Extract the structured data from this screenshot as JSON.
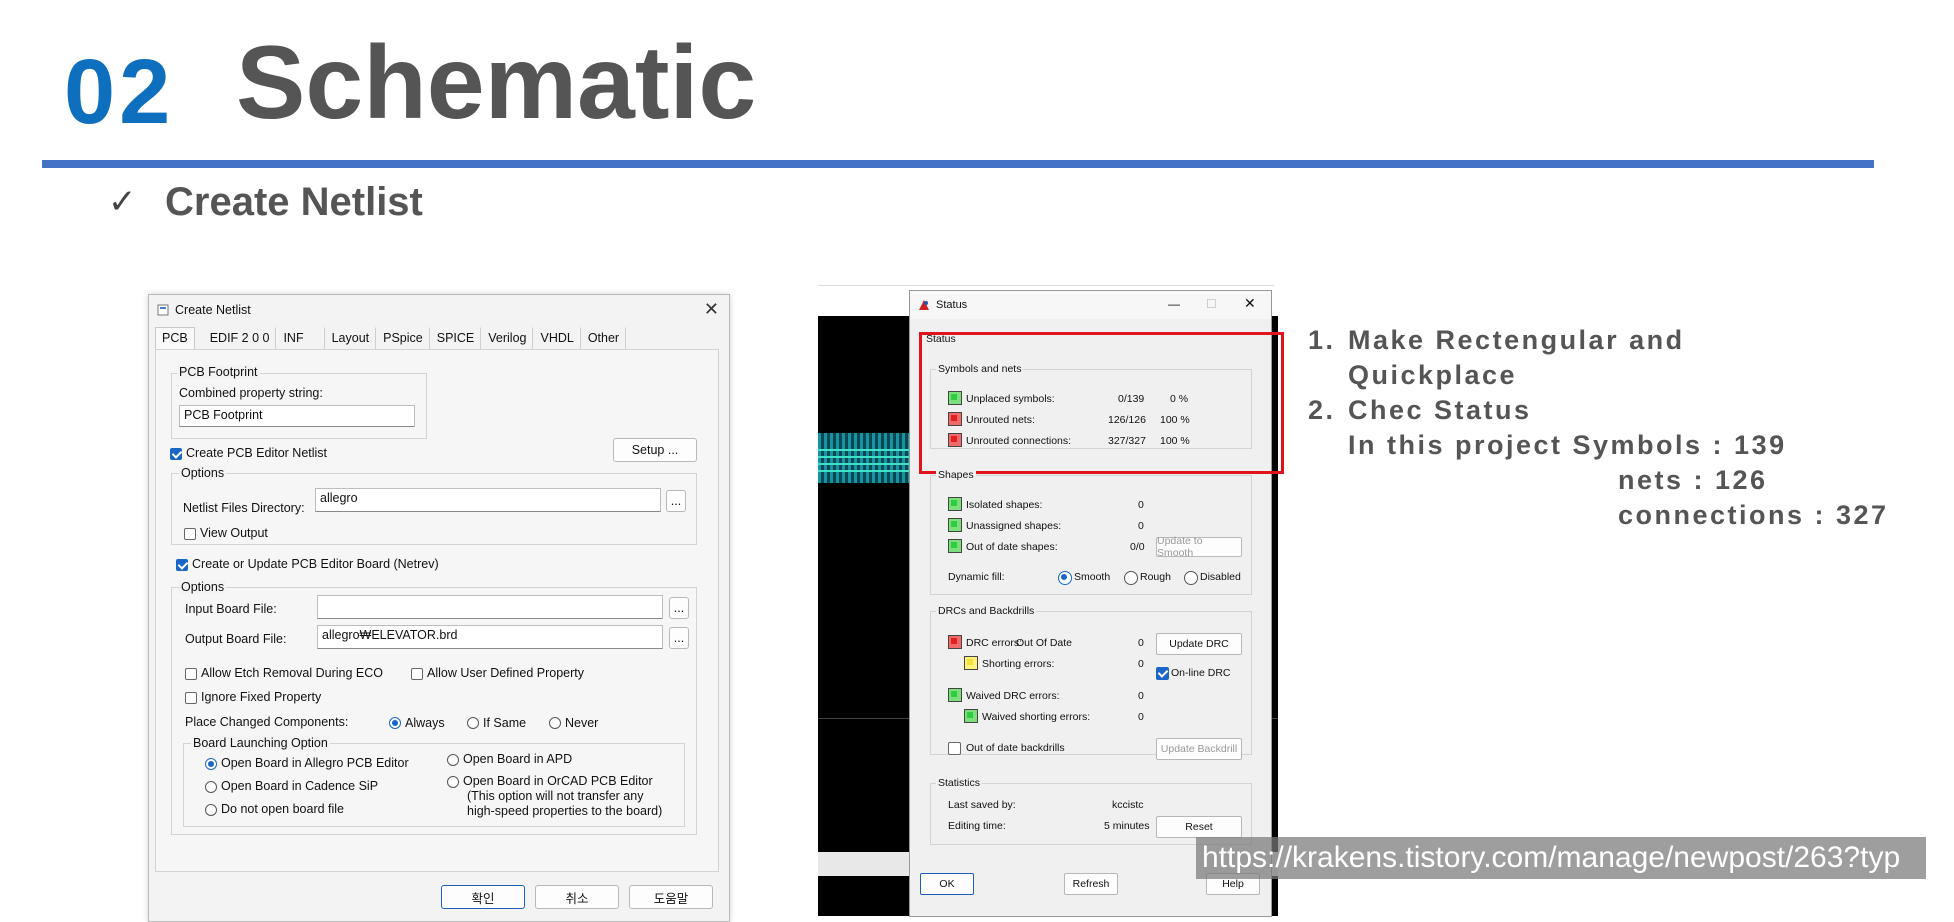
{
  "slide": {
    "number": "02",
    "title": "Schematic",
    "subtitle": "Create Netlist",
    "checkmark": "✓"
  },
  "netlist_dialog": {
    "title": "Create Netlist",
    "close": "✕",
    "tabs": [
      "PCB",
      "EDIF 2 0 0",
      "INF",
      "Layout",
      "PSpice",
      "SPICE",
      "Verilog",
      "VHDL",
      "Other"
    ],
    "footprint_group": "PCB Footprint",
    "combined_label": "Combined property string:",
    "combined_value": "PCB Footprint",
    "create_netlist": "Create PCB Editor Netlist",
    "setup_button": "Setup ...",
    "options1": "Options",
    "netlist_dir_label": "Netlist Files Directory:",
    "netlist_dir_value": "allegro",
    "browse": "...",
    "view_output": "View Output",
    "create_board": "Create or Update PCB Editor Board (Netrev)",
    "options2": "Options",
    "input_board_label": "Input Board File:",
    "input_board_value": "",
    "output_board_label": "Output Board File:",
    "output_board_value": "allegro₩ELEVATOR.brd",
    "allow_etch": "Allow Etch Removal During ECO",
    "allow_user": "Allow User Defined Property",
    "ignore_fixed": "Ignore Fixed Property",
    "place_changed_label": "Place Changed Components:",
    "place_always": "Always",
    "place_ifsame": "If Same",
    "place_never": "Never",
    "launch_group": "Board Launching Option",
    "open_allegro": "Open Board in Allegro PCB Editor",
    "open_apd": "Open Board in APD",
    "open_sip": "Open Board in Cadence SiP",
    "open_orcad": "Open Board in OrCAD PCB Editor",
    "orcad_note1": "(This option will not transfer any",
    "orcad_note2": "high-speed properties to the board)",
    "no_open": "Do not open board file",
    "ok": "확인",
    "cancel": "취소",
    "help": "도움말"
  },
  "status_dialog": {
    "title": "Status",
    "minimize": "—",
    "maximize": "☐",
    "close": "✕",
    "status_group": "Status",
    "symbols_group": "Symbols and nets",
    "unplaced_label": "Unplaced symbols:",
    "unplaced_value": "0/139",
    "unplaced_pct": "0 %",
    "unrouted_nets_label": "Unrouted nets:",
    "unrouted_nets_value": "126/126",
    "unrouted_nets_pct": "100 %",
    "unrouted_conn_label": "Unrouted connections:",
    "unrouted_conn_value": "327/327",
    "unrouted_conn_pct": "100 %",
    "shapes_group": "Shapes",
    "isolated_label": "Isolated shapes:",
    "isolated_value": "0",
    "unassigned_label": "Unassigned shapes:",
    "unassigned_value": "0",
    "outofdate_label": "Out of date shapes:",
    "outofdate_value": "0/0",
    "update_smooth": "Update to Smooth",
    "dynamic_fill": "Dynamic fill:",
    "fill_smooth": "Smooth",
    "fill_rough": "Rough",
    "fill_disabled": "Disabled",
    "drc_group": "DRCs and Backdrills",
    "drc_label": "DRC errors:",
    "drc_state": "Out Of Date",
    "drc_value": "0",
    "update_drc": "Update DRC",
    "shorting_label": "Shorting errors:",
    "shorting_value": "0",
    "online_drc": "On-line DRC",
    "waived_label": "Waived DRC errors:",
    "waived_value": "0",
    "waived_short_label": "Waived shorting errors:",
    "waived_short_value": "0",
    "backdrills_label": "Out of date backdrills",
    "update_backdrill": "Update Backdrill",
    "stats_group": "Statistics",
    "last_saved_label": "Last saved by:",
    "last_saved_value": "kccistc",
    "editing_label": "Editing time:",
    "editing_value": "5 minutes",
    "reset": "Reset",
    "ok": "OK",
    "refresh": "Refresh",
    "help": "Help"
  },
  "notes": {
    "n1": "1.",
    "line1": "Make Rectengular and",
    "line1b": "Quickplace",
    "n2": "2.",
    "line2": "Chec Status",
    "line3": "In this project Symbols : 139",
    "line4": "nets : 126",
    "line5": "connections : 327"
  },
  "watermark": "https://krakens.tistory.com/manage/newpost/263?typ",
  "colors": {
    "accent_blue": "#0e6fbf",
    "rule_blue": "#4472c4",
    "highlight_red": "#e0141b"
  }
}
